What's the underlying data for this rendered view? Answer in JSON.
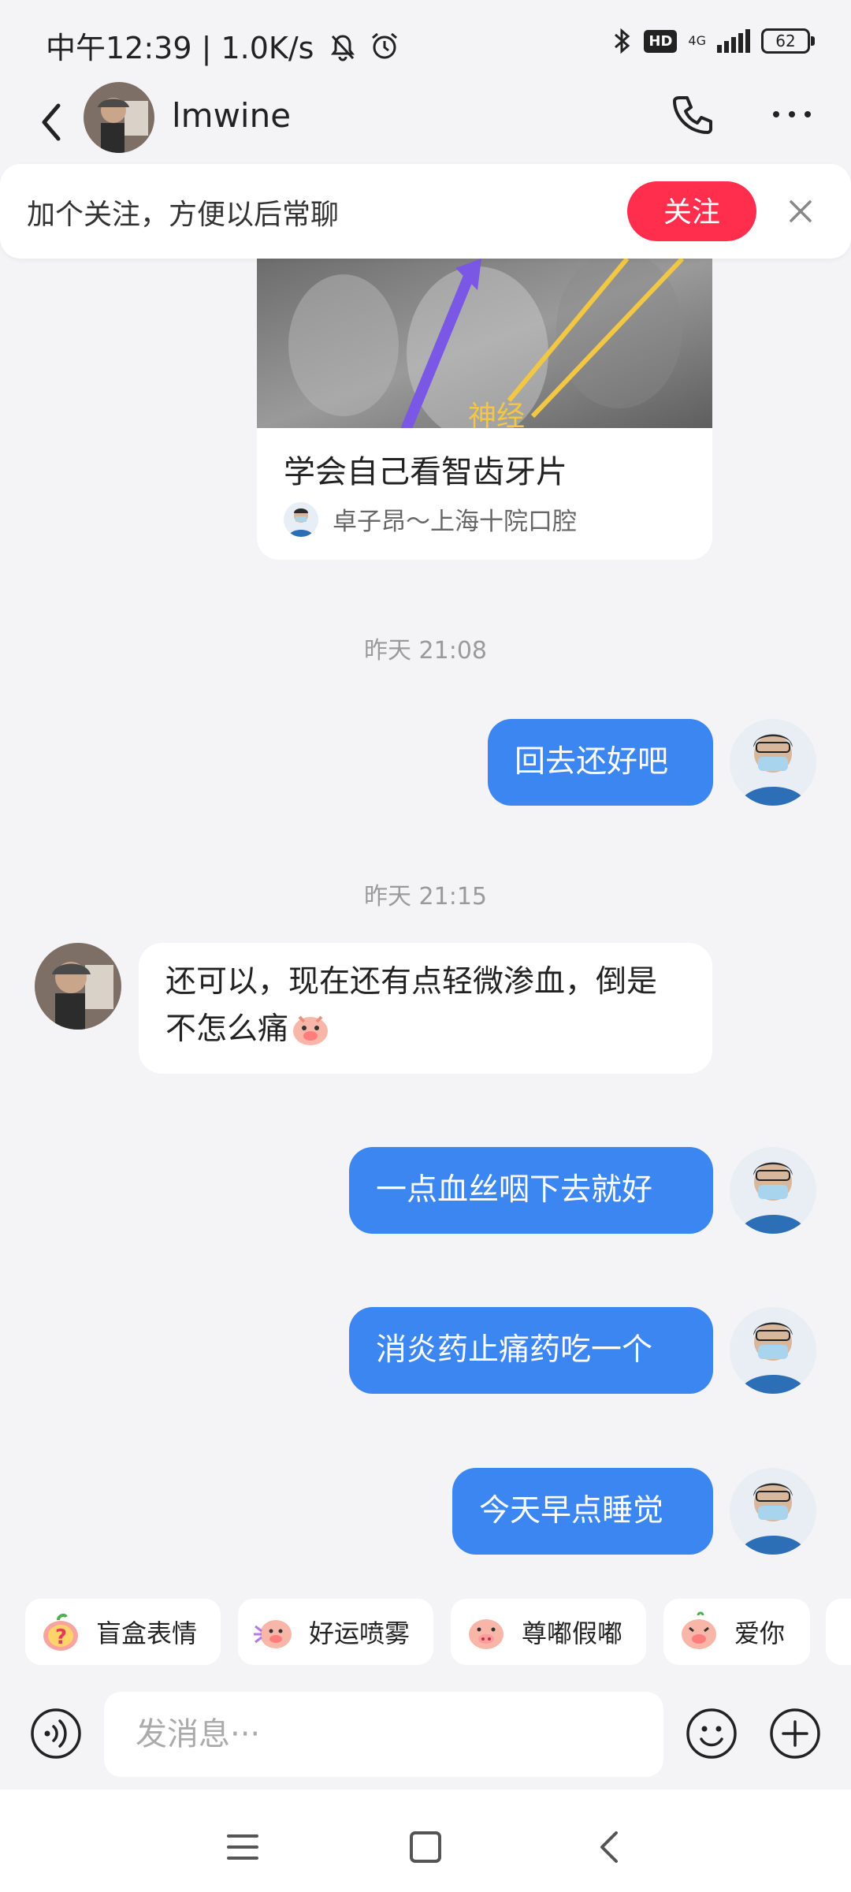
{
  "status_bar": {
    "time_net": "中午12:39 | 1.0K/s",
    "hd": "HD",
    "net_type": "4G",
    "battery": "62"
  },
  "header": {
    "title": "lmwine"
  },
  "follow_bar": {
    "text": "加个关注，方便以后常聊",
    "button": "关注"
  },
  "card": {
    "image_label": "神经",
    "title": "学会自己看智齿牙片",
    "author": "卓子昂～上海十院口腔"
  },
  "messages": [
    {
      "type": "timestamp",
      "text": "昨天 21:08"
    },
    {
      "type": "out",
      "text": "回去还好吧"
    },
    {
      "type": "timestamp",
      "text": "昨天 21:15"
    },
    {
      "type": "in",
      "text": "还可以，现在还有点轻微渗血，倒是不怎么痛"
    },
    {
      "type": "out",
      "text": "一点血丝咽下去就好"
    },
    {
      "type": "out",
      "text": "消炎药止痛药吃一个"
    },
    {
      "type": "out",
      "text": "今天早点睡觉"
    }
  ],
  "stickers": [
    {
      "label": "盲盒表情",
      "icon": "mystery-box-sticker-icon"
    },
    {
      "label": "好运喷雾",
      "icon": "lucky-spray-sticker-icon"
    },
    {
      "label": "尊嘟假嘟",
      "icon": "really-sticker-icon"
    },
    {
      "label": "爱你",
      "icon": "love-you-sticker-icon"
    }
  ],
  "input": {
    "placeholder": "发消息···"
  },
  "colors": {
    "accent_blue": "#3c86f1",
    "follow_red": "#ff2e4d",
    "background": "#f4f4f6"
  }
}
